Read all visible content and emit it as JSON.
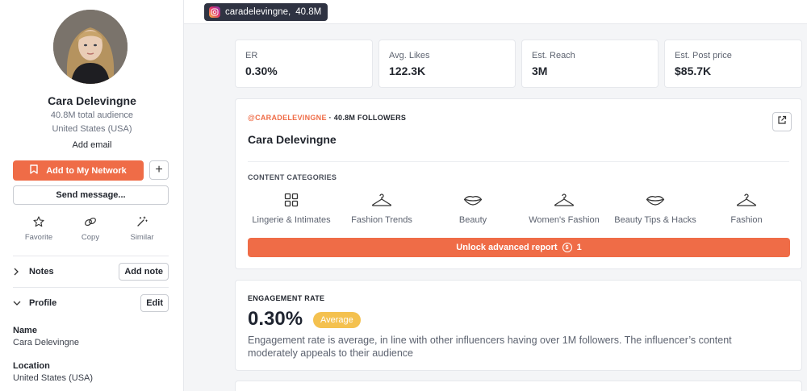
{
  "profile": {
    "name": "Cara Delevingne",
    "audience": "40.8M total audience",
    "country": "United States (USA)",
    "add_email": "Add email",
    "add_network_label": "Add to My Network",
    "plus_label": "+",
    "send_message_label": "Send message...",
    "quick_actions": [
      {
        "label": "Favorite",
        "icon": "star-icon"
      },
      {
        "label": "Copy",
        "icon": "link-icon"
      },
      {
        "label": "Similar",
        "icon": "magic-wand-icon"
      }
    ],
    "notes": {
      "label": "Notes",
      "button": "Add note"
    },
    "profile_section": {
      "label": "Profile",
      "button": "Edit"
    },
    "fields": [
      {
        "label": "Name",
        "value": "Cara Delevingne"
      },
      {
        "label": "Location",
        "value": "United States (USA)"
      }
    ]
  },
  "header": {
    "handle": "caradelevingne,",
    "followers": "40.8M",
    "icon": "instagram-icon"
  },
  "stats": [
    {
      "label": "ER",
      "value": "0.30%"
    },
    {
      "label": "Avg. Likes",
      "value": "122.3K"
    },
    {
      "label": "Est. Reach",
      "value": "3M"
    },
    {
      "label": "Est. Post price",
      "value": "$85.7K"
    }
  ],
  "overview": {
    "handle": "@CARADELEVINGNE",
    "followers_text": "· 40.8M FOLLOWERS",
    "name": "Cara Delevingne",
    "categories_title": "CONTENT CATEGORIES",
    "categories": [
      {
        "label": "Lingerie & Intimates",
        "icon": "grid-icon"
      },
      {
        "label": "Fashion Trends",
        "icon": "hanger-icon"
      },
      {
        "label": "Beauty",
        "icon": "lips-icon"
      },
      {
        "label": "Women's Fashion",
        "icon": "hanger-icon"
      },
      {
        "label": "Beauty Tips & Hacks",
        "icon": "lips-icon"
      },
      {
        "label": "Fashion",
        "icon": "hanger-icon"
      }
    ],
    "unlock_label": "Unlock advanced report",
    "unlock_cost": "1"
  },
  "engagement": {
    "title": "ENGAGEMENT RATE",
    "value": "0.30%",
    "badge": "Average",
    "description": "Engagement rate is average, in line with other influencers having over 1M followers. The influencer’s content moderately appeals to their audience"
  },
  "colors": {
    "accent": "#ef6c47",
    "badge": "#f4c14f",
    "chip": "#2f3342"
  }
}
